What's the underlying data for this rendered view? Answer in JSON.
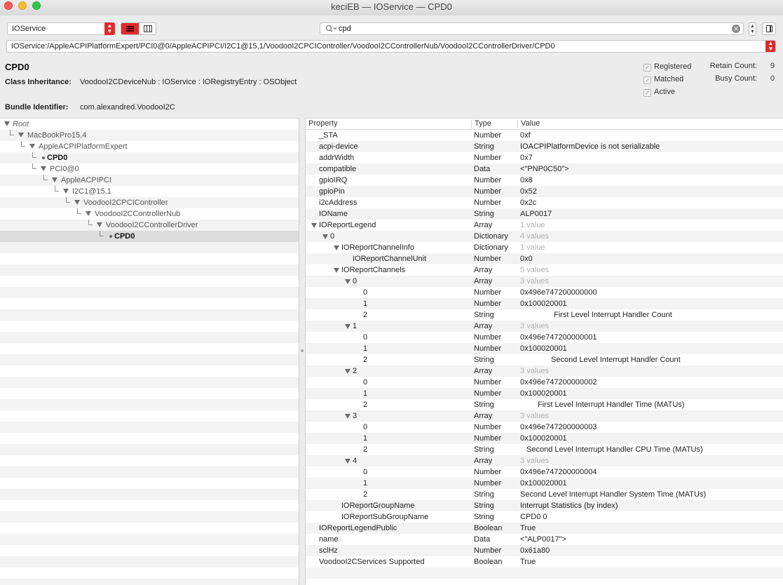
{
  "window": {
    "title": "keciEB — IOService — CPD0"
  },
  "toolbar": {
    "plane": "IOService",
    "search": {
      "value": "cpd"
    }
  },
  "path": "IOService:/AppleACPIPlatformExpert/PCI0@0/AppleACPIPCI/I2C1@15,1/VoodooI2CPCIController/VoodooI2CControllerNub/VoodooI2CControllerDriver/CPD0",
  "header": {
    "title": "CPD0",
    "class_inheritance_label": "Class Inheritance:",
    "class_inheritance": "VoodooI2CDeviceNub : IOService : IORegistryEntry : OSObject",
    "bundle_label": "Bundle Identifier:",
    "bundle": "com.alexandred.VoodooI2C",
    "registered": "Registered",
    "matched": "Matched",
    "active": "Active",
    "retain_label": "Retain Count:",
    "retain": "9",
    "busy_label": "Busy Count:",
    "busy": "0"
  },
  "tree": [
    {
      "label": "Root",
      "level": 0,
      "kind": "expanded",
      "style": "italic"
    },
    {
      "label": "MacBookPro15,4",
      "level": 1,
      "kind": "expanded"
    },
    {
      "label": "AppleACPIPlatformExpert",
      "level": 2,
      "kind": "expanded"
    },
    {
      "label": "CPD0",
      "level": 3,
      "kind": "leaf",
      "style": "bold"
    },
    {
      "label": "PCI0@0",
      "level": 3,
      "kind": "expanded"
    },
    {
      "label": "AppleACPIPCI",
      "level": 4,
      "kind": "expanded"
    },
    {
      "label": "I2C1@15,1",
      "level": 5,
      "kind": "expanded"
    },
    {
      "label": "VoodooI2CPCIController",
      "level": 6,
      "kind": "expanded"
    },
    {
      "label": "VoodooI2CControllerNub",
      "level": 7,
      "kind": "expanded"
    },
    {
      "label": "VoodooI2CControllerDriver",
      "level": 8,
      "kind": "expanded"
    },
    {
      "label": "CPD0",
      "level": 9,
      "kind": "leaf",
      "style": "bold",
      "selected": true
    }
  ],
  "columns": {
    "property": "Property",
    "type": "Type",
    "value": "Value"
  },
  "properties": [
    {
      "name": "_STA",
      "level": 0,
      "type": "Number",
      "value": "0xf"
    },
    {
      "name": "acpi-device",
      "level": 0,
      "type": "String",
      "value": "IOACPIPlatformDevice is not serializable"
    },
    {
      "name": "addrWidth",
      "level": 0,
      "type": "Number",
      "value": "0x7"
    },
    {
      "name": "compatible",
      "level": 0,
      "type": "Data",
      "value": "<\"PNP0C50\">"
    },
    {
      "name": "gpioIRQ",
      "level": 0,
      "type": "Number",
      "value": "0x8"
    },
    {
      "name": "gpioPin",
      "level": 0,
      "type": "Number",
      "value": "0x52"
    },
    {
      "name": "i2cAddress",
      "level": 0,
      "type": "Number",
      "value": "0x2c"
    },
    {
      "name": "IOName",
      "level": 0,
      "type": "String",
      "value": "ALP0017"
    },
    {
      "name": "IOReportLegend",
      "level": 0,
      "type": "Array",
      "value": "1 value",
      "expanded": true,
      "muted": true
    },
    {
      "name": "0",
      "level": 1,
      "type": "Dictionary",
      "value": "4 values",
      "expanded": true,
      "muted": true
    },
    {
      "name": "IOReportChannelInfo",
      "level": 2,
      "type": "Dictionary",
      "value": "1 value",
      "expanded": true,
      "muted": true
    },
    {
      "name": "IOReportChannelUnit",
      "level": 3,
      "type": "Number",
      "value": "0x0"
    },
    {
      "name": "IOReportChannels",
      "level": 2,
      "type": "Array",
      "value": "5 values",
      "expanded": true,
      "muted": true
    },
    {
      "name": "0",
      "level": 3,
      "type": "Array",
      "value": "3 values",
      "expanded": true,
      "muted": true
    },
    {
      "name": "0",
      "level": 4,
      "type": "Number",
      "value": "0x496e747200000000"
    },
    {
      "name": "1",
      "level": 4,
      "type": "Number",
      "value": "0x100020001"
    },
    {
      "name": "2",
      "level": 4,
      "type": "String",
      "value": "First Level Interrupt Handler Count",
      "indent_value": 48
    },
    {
      "name": "1",
      "level": 3,
      "type": "Array",
      "value": "3 values",
      "expanded": true,
      "muted": true
    },
    {
      "name": "0",
      "level": 4,
      "type": "Number",
      "value": "0x496e747200000001"
    },
    {
      "name": "1",
      "level": 4,
      "type": "Number",
      "value": "0x100020001"
    },
    {
      "name": "2",
      "level": 4,
      "type": "String",
      "value": "Second Level Interrupt Handler Count",
      "indent_value": 44
    },
    {
      "name": "2",
      "level": 3,
      "type": "Array",
      "value": "3 values",
      "expanded": true,
      "muted": true
    },
    {
      "name": "0",
      "level": 4,
      "type": "Number",
      "value": "0x496e747200000002"
    },
    {
      "name": "1",
      "level": 4,
      "type": "Number",
      "value": "0x100020001"
    },
    {
      "name": "2",
      "level": 4,
      "type": "String",
      "value": "First Level Interrupt Handler Time (MATUs)",
      "indent_value": 25
    },
    {
      "name": "3",
      "level": 3,
      "type": "Array",
      "value": "3 values",
      "expanded": true,
      "muted": true
    },
    {
      "name": "0",
      "level": 4,
      "type": "Number",
      "value": "0x496e747200000003"
    },
    {
      "name": "1",
      "level": 4,
      "type": "Number",
      "value": "0x100020001"
    },
    {
      "name": "2",
      "level": 4,
      "type": "String",
      "value": "Second Level Interrupt Handler CPU Time (MATUs)",
      "indent_value": 9
    },
    {
      "name": "4",
      "level": 3,
      "type": "Array",
      "value": "3 values",
      "expanded": true,
      "muted": true
    },
    {
      "name": "0",
      "level": 4,
      "type": "Number",
      "value": "0x496e747200000004"
    },
    {
      "name": "1",
      "level": 4,
      "type": "Number",
      "value": "0x100020001"
    },
    {
      "name": "2",
      "level": 4,
      "type": "String",
      "value": "Second Level Interrupt Handler System Time (MATUs)",
      "indent_value": 0
    },
    {
      "name": "IOReportGroupName",
      "level": 2,
      "type": "String",
      "value": "Interrupt Statistics (by index)"
    },
    {
      "name": "IOReportSubGroupName",
      "level": 2,
      "type": "String",
      "value": "CPD0 0"
    },
    {
      "name": "IOReportLegendPublic",
      "level": 0,
      "type": "Boolean",
      "value": "True"
    },
    {
      "name": "name",
      "level": 0,
      "type": "Data",
      "value": "<\"ALP0017\">"
    },
    {
      "name": "sclHz",
      "level": 0,
      "type": "Number",
      "value": "0x61a80"
    },
    {
      "name": "VoodooI2CServices Supported",
      "level": 0,
      "type": "Boolean",
      "value": "True"
    }
  ],
  "colors": {
    "accent": "#e12b2b",
    "stripe": "#f3f3f3",
    "selected_row": "#dcdcdc"
  }
}
